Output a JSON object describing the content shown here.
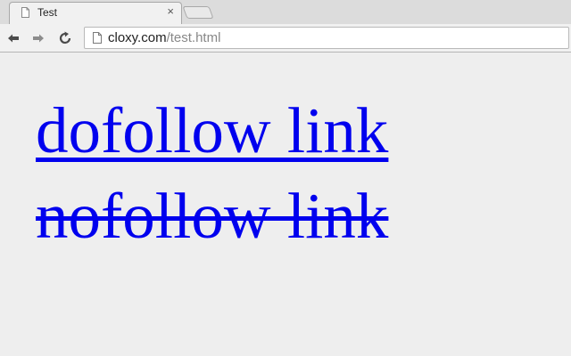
{
  "browser": {
    "tab": {
      "title": "Test",
      "close_glyph": "×",
      "favicon_icon": "page-icon"
    },
    "new_tab_icon": "new-tab-icon",
    "toolbar": {
      "back_icon": "back-arrow-icon",
      "forward_icon": "forward-arrow-icon",
      "reload_icon": "reload-icon"
    },
    "address_bar": {
      "host": "cloxy.com",
      "path": "/test.html",
      "page_icon": "page-icon"
    }
  },
  "page": {
    "links": [
      {
        "label": "dofollow link",
        "style": "underline"
      },
      {
        "label": "nofollow link",
        "style": "line-through"
      }
    ],
    "link_color": "#0000ee"
  }
}
